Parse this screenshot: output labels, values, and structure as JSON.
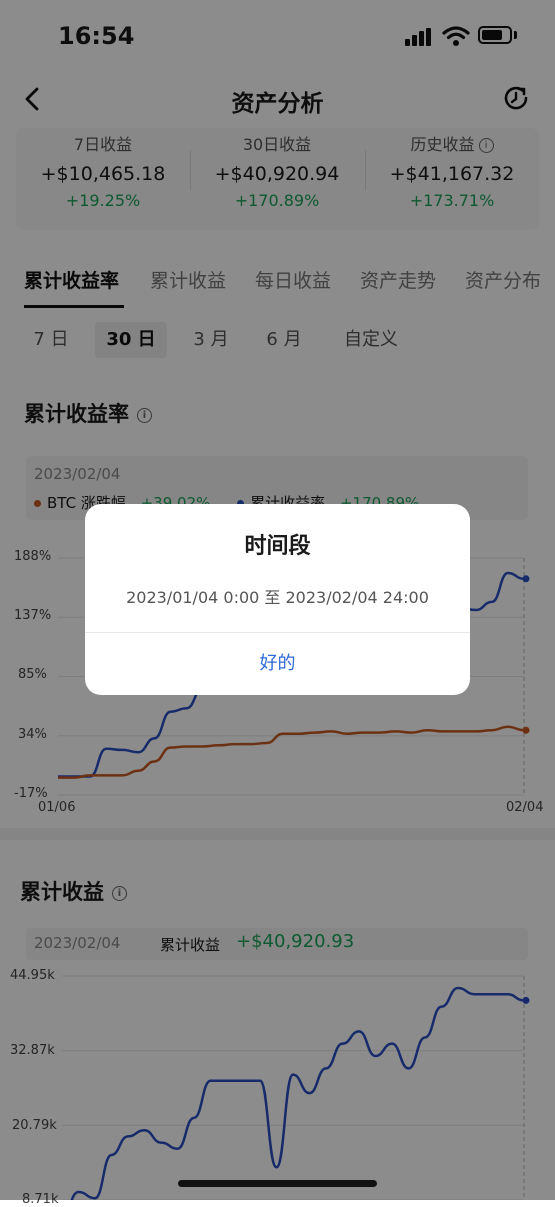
{
  "status_bar": {
    "time": "16:54"
  },
  "nav": {
    "title": "资产分析"
  },
  "summary": [
    {
      "label": "7日收益",
      "value": "+$10,465.18",
      "pct": "+19.25%"
    },
    {
      "label": "30日收益",
      "value": "+$40,920.94",
      "pct": "+170.89%"
    },
    {
      "label": "历史收益",
      "value": "+$41,167.32",
      "pct": "+173.71%"
    }
  ],
  "tabs": [
    "累计收益率",
    "累计收益",
    "每日收益",
    "资产走势",
    "资产分布"
  ],
  "ranges": [
    "7 日",
    "30 日",
    "3 月",
    "6 月",
    "自定义"
  ],
  "section1": {
    "title": "累计收益率",
    "date": "2023/02/04",
    "legend": [
      {
        "name": "BTC 涨跌幅",
        "value": "+39.02%",
        "color": "#c45a22"
      },
      {
        "name": "累计收益率",
        "value": "+170.89%",
        "color": "#2b4fc4"
      }
    ]
  },
  "section2": {
    "title": "累计收益",
    "date": "2023/02/04",
    "label": "累计收益",
    "value": "+$40,920.93"
  },
  "dialog": {
    "title": "时间段",
    "message": "2023/01/04 0:00 至 2023/02/04 24:00",
    "ok": "好的"
  },
  "chart_data": [
    {
      "type": "line",
      "title": "累计收益率",
      "x_ticks": [
        "01/06",
        "02/04"
      ],
      "y_ticks": [
        "188%",
        "137%",
        "85%",
        "34%",
        "-17%"
      ],
      "ylim": [
        -17,
        188
      ],
      "x": [
        0,
        1,
        2,
        3,
        4,
        5,
        6,
        7,
        8,
        9,
        10,
        11,
        12,
        13,
        14,
        15,
        16,
        17,
        18,
        19,
        20,
        21,
        22,
        23,
        24,
        25,
        26,
        27,
        28,
        29
      ],
      "series": [
        {
          "name": "累计收益率",
          "color": "#2b4fc4",
          "values": [
            -1,
            -1,
            -1,
            23,
            22,
            20,
            32,
            55,
            58,
            75,
            100,
            125,
            133,
            128,
            110,
            108,
            111,
            118,
            115,
            114,
            122,
            121,
            132,
            143,
            148,
            145,
            143,
            150,
            175,
            170
          ]
        },
        {
          "name": "BTC 涨跌幅",
          "color": "#c45a22",
          "values": [
            -2,
            -2,
            0,
            0,
            0,
            4,
            12,
            24,
            25,
            25,
            26,
            27,
            27,
            28,
            36,
            36,
            37,
            38,
            36,
            37,
            37,
            38,
            37,
            39,
            38,
            38,
            38,
            39,
            42,
            39
          ]
        }
      ]
    },
    {
      "type": "line",
      "title": "累计收益",
      "x_ticks": [],
      "y_ticks": [
        "44.95k",
        "32.87k",
        "20.79k",
        "8.71k"
      ],
      "ylim": [
        8.71,
        44.95
      ],
      "x": [
        0,
        1,
        2,
        3,
        4,
        5,
        6,
        7,
        8,
        9,
        10,
        11,
        12,
        13,
        14,
        15,
        16,
        17,
        18,
        19,
        20,
        21,
        22,
        23,
        24,
        25,
        26,
        27,
        28
      ],
      "series": [
        {
          "name": "累计收益",
          "color": "#2b4fc4",
          "values": [
            6,
            10,
            9,
            16,
            19,
            20,
            18,
            17,
            22,
            28,
            28,
            28,
            28,
            14,
            29,
            26,
            30,
            34,
            36,
            32,
            34,
            30,
            35,
            40,
            43,
            42,
            42,
            42,
            41
          ]
        }
      ]
    }
  ]
}
